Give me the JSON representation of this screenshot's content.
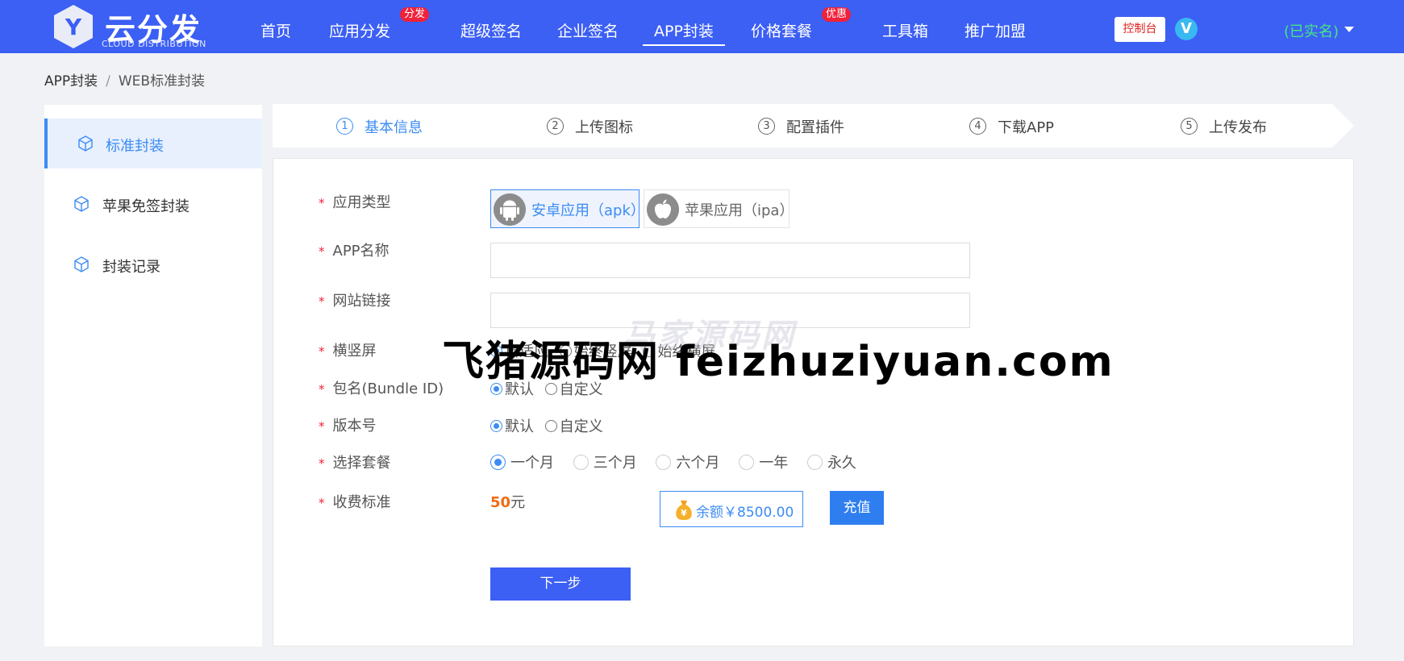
{
  "header": {
    "logo": {
      "name": "云分发",
      "subtitle": "CLOUD DISTRIBUTION",
      "mark": "Y"
    },
    "nav": [
      {
        "label": "首页"
      },
      {
        "label": "应用分发",
        "badge": "分发"
      },
      {
        "label": "超级签名"
      },
      {
        "label": "企业签名"
      },
      {
        "label": "APP封装",
        "active": true
      },
      {
        "label": "价格套餐",
        "badge": "优惠"
      },
      {
        "label": "工具箱"
      },
      {
        "label": "推广加盟"
      }
    ],
    "console_label": "控制台",
    "vip_mark": "V",
    "user_status": "(已实名)"
  },
  "breadcrumb": {
    "root": "APP封装",
    "separator": "/",
    "current": "WEB标准封装"
  },
  "sidebar": {
    "items": [
      {
        "label": "标准封装",
        "icon": "cube-icon",
        "active": true
      },
      {
        "label": "苹果免签封装",
        "icon": "cube-icon"
      },
      {
        "label": "封装记录",
        "icon": "cube-icon"
      }
    ]
  },
  "steps": [
    {
      "num": "1",
      "label": "基本信息",
      "active": true
    },
    {
      "num": "2",
      "label": "上传图标"
    },
    {
      "num": "3",
      "label": "配置插件"
    },
    {
      "num": "4",
      "label": "下载APP"
    },
    {
      "num": "5",
      "label": "上传发布"
    }
  ],
  "form": {
    "required_mark": "*",
    "app_type": {
      "label": "应用类型",
      "options": [
        {
          "label": "安卓应用（apk）",
          "icon": "android-icon",
          "selected": true
        },
        {
          "label": "苹果应用（ipa）",
          "icon": "apple-icon"
        }
      ]
    },
    "app_name": {
      "label": "APP名称",
      "value": "",
      "placeholder": ""
    },
    "site_url": {
      "label": "网站链接",
      "value": "",
      "placeholder": ""
    },
    "orientation": {
      "label": "横竖屏",
      "options": [
        "自适应",
        "始终竖屏",
        "始终横屏"
      ],
      "selected": 0
    },
    "bundle_id": {
      "label": "包名(Bundle ID)",
      "options": [
        "默认",
        "自定义"
      ],
      "selected": 0
    },
    "version": {
      "label": "版本号",
      "options": [
        "默认",
        "自定义"
      ],
      "selected": 0
    },
    "package": {
      "label": "选择套餐",
      "options": [
        "一个月",
        "三个月",
        "六个月",
        "一年",
        "永久"
      ],
      "selected": 0
    },
    "fee": {
      "label": "收费标准",
      "amount": "50",
      "unit": "元"
    },
    "balance": {
      "text": "余额￥8500.00",
      "icon": "money-bag-icon"
    },
    "recharge_label": "充值",
    "next_label": "下一步"
  },
  "watermarks": {
    "faint": "马家源码网",
    "main": "飞猪源码网 feizhuziyuan.com"
  },
  "colors": {
    "primary": "#3c5ff4",
    "accent": "#3c8cf4",
    "badge": "#f0213a",
    "verified": "#47e685",
    "fee": "#f06b14"
  }
}
